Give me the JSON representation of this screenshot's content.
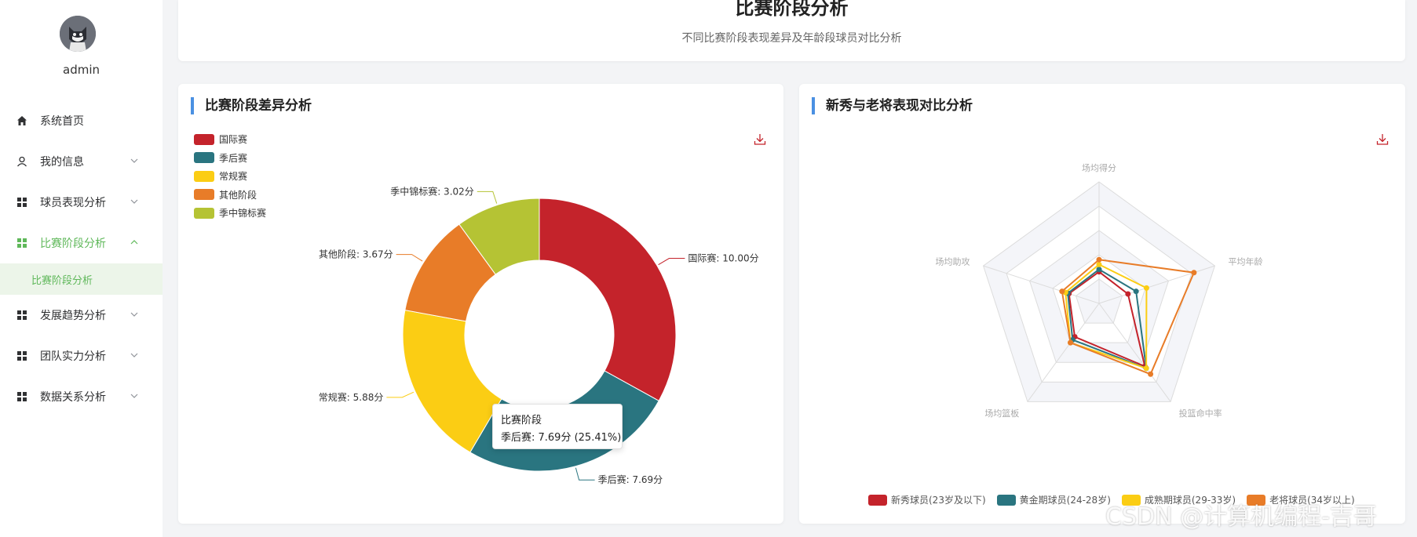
{
  "sidebar": {
    "username": "admin",
    "menu": [
      {
        "label": "系统首页",
        "icon": "home-icon",
        "expandable": false
      },
      {
        "label": "我的信息",
        "icon": "user-icon",
        "expandable": true
      },
      {
        "label": "球员表现分析",
        "icon": "grid-icon",
        "expandable": true
      },
      {
        "label": "比赛阶段分析",
        "icon": "grid-icon",
        "expandable": true,
        "active": true
      },
      {
        "label": "发展趋势分析",
        "icon": "grid-icon",
        "expandable": true
      },
      {
        "label": "团队实力分析",
        "icon": "grid-icon",
        "expandable": true
      },
      {
        "label": "数据关系分析",
        "icon": "grid-icon",
        "expandable": true
      }
    ],
    "submenu": {
      "label": "比赛阶段分析"
    }
  },
  "header": {
    "title": "比赛阶段分析",
    "subtitle": "不同比赛阶段表现差异及年龄段球员对比分析"
  },
  "left_panel": {
    "title": "比赛阶段差异分析",
    "tooltip": {
      "title": "比赛阶段",
      "body": "季后赛: 7.69分 (25.41%)"
    }
  },
  "right_panel": {
    "title": "新秀与老将表现对比分析"
  },
  "colors": {
    "red": "#c4232b",
    "teal": "#2a7580",
    "yellow": "#fbcd14",
    "orange": "#e87c28",
    "olive": "#b5c334",
    "accent": "#5fb85a",
    "title_bar": "#4a90e2"
  },
  "chart_data": [
    {
      "type": "pie",
      "donut": true,
      "legend": [
        "国际赛",
        "季后赛",
        "常规赛",
        "其他阶段",
        "季中锦标赛"
      ],
      "legend_position": "top-left",
      "series": [
        {
          "name": "国际赛",
          "value": 10.0,
          "label": "国际赛: 10.00分",
          "color": "#c4232b"
        },
        {
          "name": "季后赛",
          "value": 7.69,
          "label": "季后赛: 7.69分",
          "color": "#2a7580"
        },
        {
          "name": "常规赛",
          "value": 5.88,
          "label": "常规赛: 5.88分",
          "color": "#fbcd14"
        },
        {
          "name": "其他阶段",
          "value": 3.67,
          "label": "其他阶段: 3.67分",
          "color": "#e87c28"
        },
        {
          "name": "季中锦标赛",
          "value": 3.02,
          "label": "季中锦标赛: 3.02分",
          "color": "#b5c334"
        }
      ]
    },
    {
      "type": "radar",
      "indicators": [
        "场均得分",
        "平均年龄",
        "投篮命中率",
        "场均篮板",
        "场均助攻"
      ],
      "legend_position": "bottom",
      "series": [
        {
          "name": "新秀球员(23岁及以下)",
          "color": "#c4232b",
          "values": [
            0.26,
            0.25,
            0.64,
            0.34,
            0.26
          ]
        },
        {
          "name": "黄金期球员(24-28岁)",
          "color": "#2a7580",
          "values": [
            0.28,
            0.32,
            0.66,
            0.37,
            0.27
          ]
        },
        {
          "name": "成熟期球员(29-33岁)",
          "color": "#fbcd14",
          "values": [
            0.32,
            0.41,
            0.66,
            0.4,
            0.29
          ]
        },
        {
          "name": "老将球员(34岁以上)",
          "color": "#e87c28",
          "values": [
            0.36,
            0.82,
            0.72,
            0.4,
            0.32
          ]
        }
      ]
    }
  ],
  "watermark": "CSDN @计算机编程-吉哥"
}
